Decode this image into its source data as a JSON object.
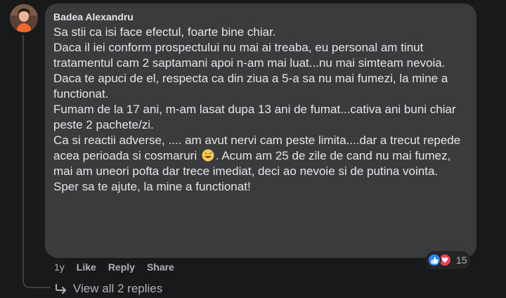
{
  "comment": {
    "author": "Badea Alexandru",
    "lines": [
      "Sa stii ca isi face efectul, foarte bine chiar.",
      "Daca il iei conform prospectului nu mai ai treaba, eu personal am tinut tratamentul cam 2 saptamani apoi n-am mai luat...nu mai simteam nevoia.",
      "Daca te apuci de el, respecta ca din ziua a 5-a sa nu mai fumezi, la mine a functionat.",
      "Fumam de la 17 ani, m-am lasat dupa 13 ani de fumat...cativa ani buni chiar peste 2 pachete/zi."
    ],
    "line5_before_emoji": "Ca si reactii adverse, .... am avut nervi cam peste limita....dar a trecut repede acea perioada si cosmaruri ",
    "emoji_name": "grinning-sweat-emoji",
    "line5_after_emoji": ". Acum am 25 de zile de cand nu mai fumez, mai am uneori pofta dar trece imediat, deci ao nevoie si de putina vointa.",
    "last_line": "Sper sa te ajute, la mine a functionat!",
    "reactions": {
      "icons": [
        "like-icon",
        "love-icon"
      ],
      "count": "15",
      "like_color": "#2d88ff",
      "love_color": "#f33e58"
    }
  },
  "actions": {
    "time": "1y",
    "like": "Like",
    "reply": "Reply",
    "share": "Share"
  },
  "replies": {
    "label": "View all 2 replies",
    "icon": "reply-arrow-icon"
  },
  "colors": {
    "background": "#18191a",
    "bubble": "#3a3b3c",
    "text": "#e4e6eb",
    "secondary": "#b0b3b8"
  }
}
